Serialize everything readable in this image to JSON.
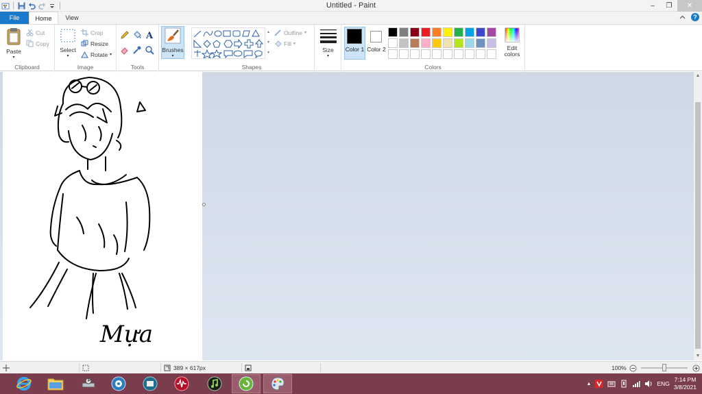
{
  "window": {
    "title": "Untitled - Paint"
  },
  "tabs": {
    "file": "File",
    "home": "Home",
    "view": "View"
  },
  "clipboard": {
    "paste": "Paste",
    "cut": "Cut",
    "copy": "Copy",
    "label": "Clipboard"
  },
  "image": {
    "select": "Select",
    "crop": "Crop",
    "resize": "Resize",
    "rotate": "Rotate",
    "label": "Image"
  },
  "tools": {
    "label": "Tools",
    "text_glyph": "A"
  },
  "brushes": {
    "label": "Brushes"
  },
  "shapes": {
    "outline": "Outline",
    "fill": "Fill",
    "label": "Shapes"
  },
  "size": {
    "label": "Size"
  },
  "colors": {
    "color1": "Color 1",
    "color2": "Color 2",
    "color1_value": "#000000",
    "color2_value": "#ffffff",
    "edit": "Edit colors",
    "label": "Colors",
    "palette_row1": [
      "#000000",
      "#7f7f7f",
      "#880015",
      "#ed1c24",
      "#ff7f27",
      "#fff200",
      "#22b14c",
      "#00a2e8",
      "#3f48cc",
      "#a349a4"
    ],
    "palette_row2": [
      "#ffffff",
      "#c3c3c3",
      "#b97a57",
      "#ffaec9",
      "#ffc90e",
      "#efe4b0",
      "#b5e61d",
      "#99d9ea",
      "#7092be",
      "#c8bfe7"
    ]
  },
  "drawing": {
    "signature": "Mựa"
  },
  "status": {
    "dimensions": "389 × 617px",
    "zoom": "100%"
  },
  "tray": {
    "lang": "ENG",
    "time": "7:14 PM",
    "date": "3/8/2021"
  }
}
